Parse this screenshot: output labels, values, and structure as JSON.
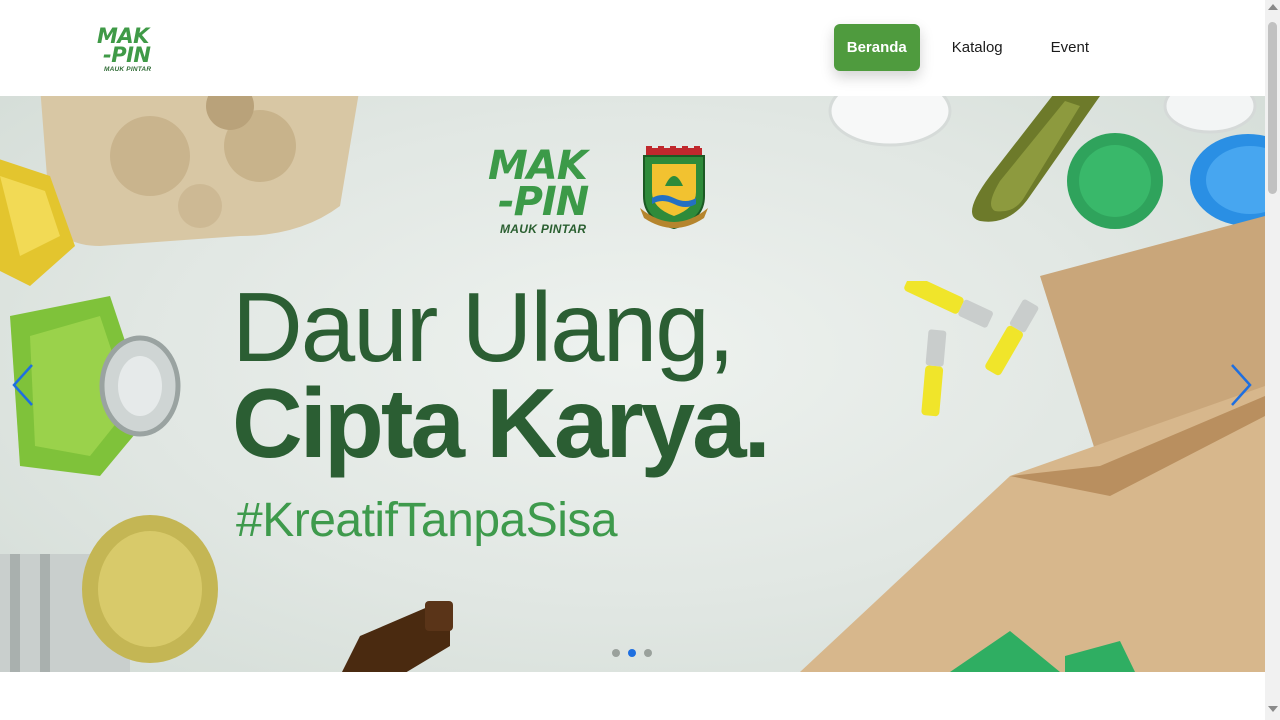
{
  "brand": {
    "logo_line1": "MAK",
    "logo_line2": "-PIN",
    "logo_tagline": "MAUK PINTAR"
  },
  "nav": {
    "items": [
      {
        "label": "Beranda",
        "active": true
      },
      {
        "label": "Katalog",
        "active": false
      },
      {
        "label": "Event",
        "active": false
      }
    ]
  },
  "hero": {
    "logo_line1": "MAK",
    "logo_line2": "-PIN",
    "logo_tagline": "MAUK PINTAR",
    "headline_line1": "Daur Ulang,",
    "headline_line2": "Cipta Karya.",
    "hashtag": "#KreatifTanpaSisa",
    "prev_icon": "chevron-left-icon",
    "next_icon": "chevron-right-icon",
    "slide_count": 3,
    "active_slide": 2
  },
  "colors": {
    "brand_green": "#4f9b3e",
    "headline_green": "#2b5e33",
    "hashtag_green": "#3e9a4c",
    "carousel_active": "#1e6fe0"
  }
}
